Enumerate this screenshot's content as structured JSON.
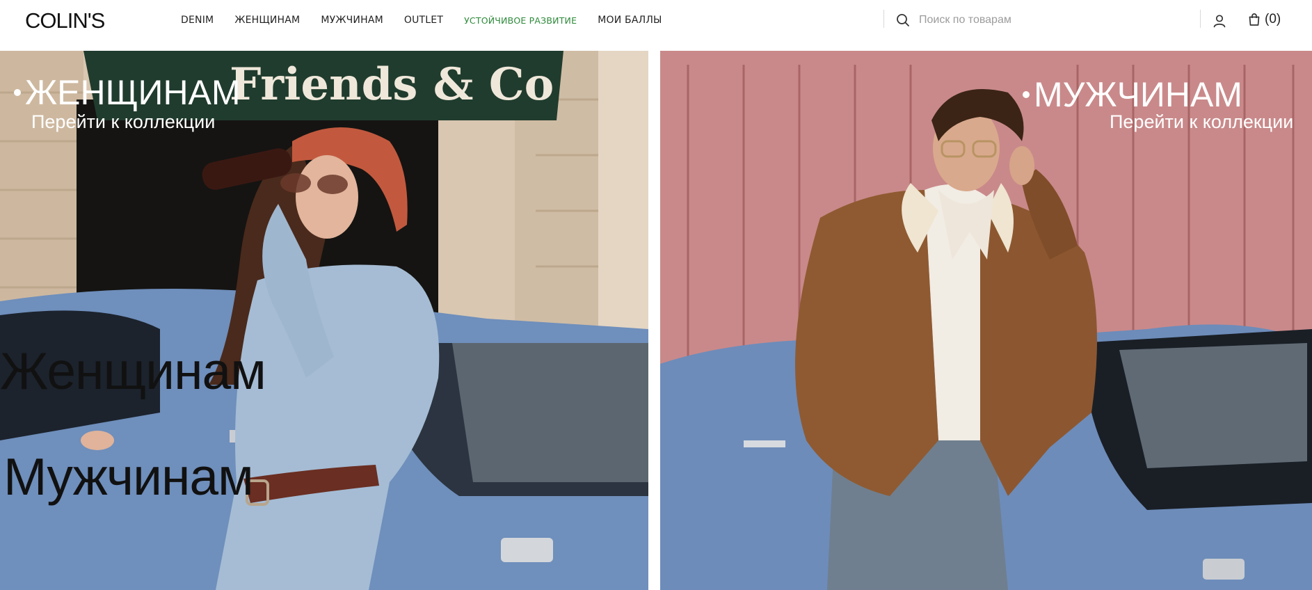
{
  "brand": {
    "logo_text": "COLIN'S"
  },
  "nav": {
    "items": [
      {
        "label": "DENIM"
      },
      {
        "label": "ЖЕНЩИНАМ"
      },
      {
        "label": "МУЖЧИНАМ"
      },
      {
        "label": "OUTLET"
      },
      {
        "label": "УСТОЙЧИВОЕ РАЗВИТИЕ"
      },
      {
        "label": "МОИ БАЛЛЫ"
      }
    ],
    "accent_color": "#2d8a3a"
  },
  "search": {
    "placeholder": "Поиск по товарам",
    "value": ""
  },
  "cart": {
    "count_label": "(0)"
  },
  "icons": [
    "search-icon",
    "user-icon",
    "cart-icon"
  ],
  "women_panel": {
    "title": "ЖЕНЩИНАМ",
    "subtitle": "Перейти к коллекции",
    "sign_text": "Friends & Co"
  },
  "men_panel": {
    "title": "МУЖЧИНАМ",
    "subtitle": "Перейти к коллекции"
  },
  "category_labels": {
    "women": "Женщинам",
    "men": "Мужчинам"
  }
}
